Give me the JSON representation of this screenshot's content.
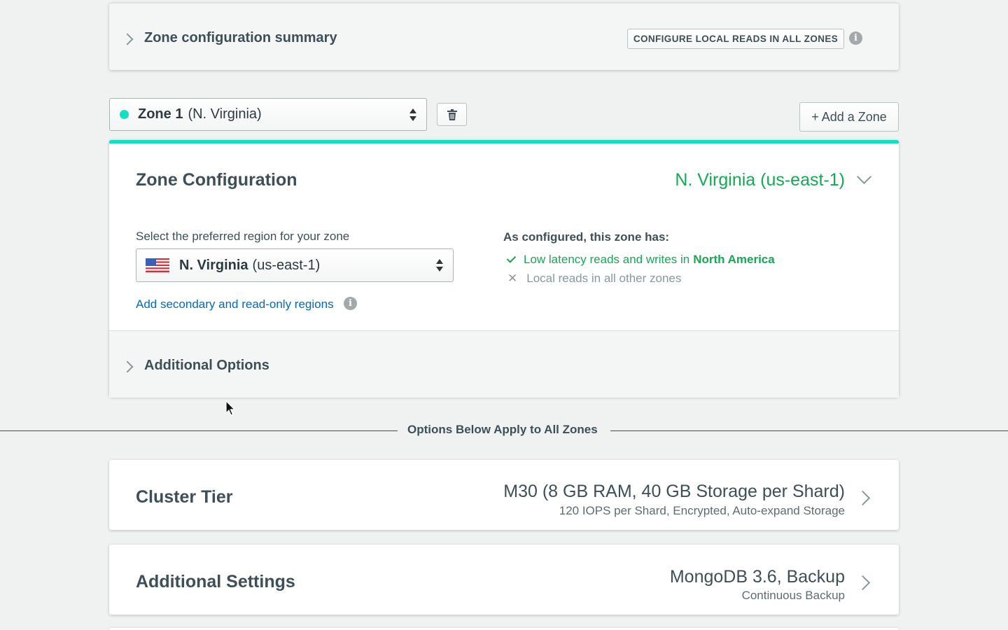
{
  "summary": {
    "title": "Zone configuration summary",
    "configure_button": "CONFIGURE LOCAL READS IN ALL ZONES"
  },
  "zone_selector": {
    "zone_name": "Zone 1",
    "zone_region": "(N. Virginia)",
    "dot_color": "#13e0c0"
  },
  "add_zone_button": "+ Add a Zone",
  "zone_config": {
    "title": "Zone Configuration",
    "region_summary": "N. Virginia (us-east-1)",
    "region_label": "Select the preferred region for your zone",
    "region_select_name": "N. Virginia",
    "region_select_code": "(us-east-1)",
    "secondary_link": "Add secondary and read-only regions",
    "configured_heading": "As configured, this zone has:",
    "feature_yes_text": "Low latency reads and writes in",
    "feature_yes_region": "North America",
    "feature_no_text": "Local reads in all other zones",
    "accent_color": "#13e0c0",
    "green_color": "#13aa52"
  },
  "additional_options": {
    "title": "Additional Options"
  },
  "divider_text": "Options Below Apply to All Zones",
  "cluster_tier": {
    "title": "Cluster Tier",
    "value": "M30 (8 GB RAM, 40 GB Storage per Shard)",
    "subvalue": "120 IOPS per Shard, Encrypted, Auto-expand Storage"
  },
  "additional_settings": {
    "title": "Additional Settings",
    "value": "MongoDB 3.6, Backup",
    "subvalue": "Continuous Backup"
  }
}
